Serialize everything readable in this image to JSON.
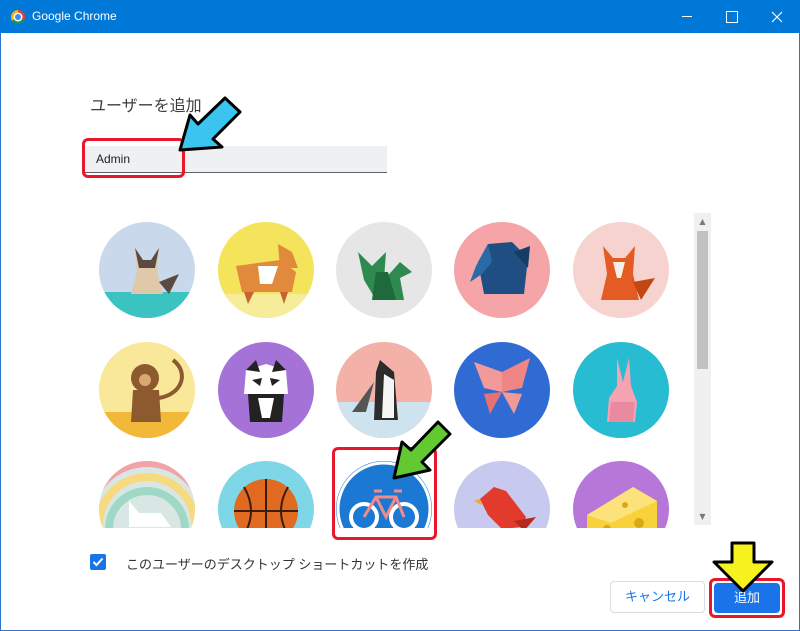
{
  "window": {
    "title": "Google Chrome"
  },
  "dialog": {
    "heading": "ユーザーを追加",
    "name_input": {
      "value": "Admin"
    },
    "avatars": [
      {
        "name": "origami-cat",
        "bg": "#c9d8ea"
      },
      {
        "name": "origami-corgi",
        "bg": "#f4e45c"
      },
      {
        "name": "origami-dragon",
        "bg": "#e6e6e6"
      },
      {
        "name": "origami-elephant",
        "bg": "#f5a5a8"
      },
      {
        "name": "origami-fox",
        "bg": "#f7d3d0"
      },
      {
        "name": "origami-monkey",
        "bg": "#f9e79a"
      },
      {
        "name": "origami-panda",
        "bg": "#a572d8"
      },
      {
        "name": "origami-penguin",
        "bg": "#f3b1a7"
      },
      {
        "name": "origami-butterfly",
        "bg": "#2f6bd3"
      },
      {
        "name": "origami-rabbit",
        "bg": "#27bcd1"
      },
      {
        "name": "origami-unicorn",
        "bg": "#d8e7e4"
      },
      {
        "name": "basketball",
        "bg": "#7fd6e6"
      },
      {
        "name": "bicycle",
        "bg": "#1b78d3"
      },
      {
        "name": "origami-bird",
        "bg": "#c7c9ef"
      },
      {
        "name": "cheese",
        "bg": "#b677d9"
      }
    ],
    "shortcut_checkbox": {
      "checked": true,
      "label": "このユーザーのデスクトップ ショートカットを作成"
    },
    "cancel_label": "キャンセル",
    "add_label": "追加"
  },
  "colors": {
    "titlebar": "#0078d7",
    "accent": "#1a73e8",
    "callout": "#e8172b"
  }
}
